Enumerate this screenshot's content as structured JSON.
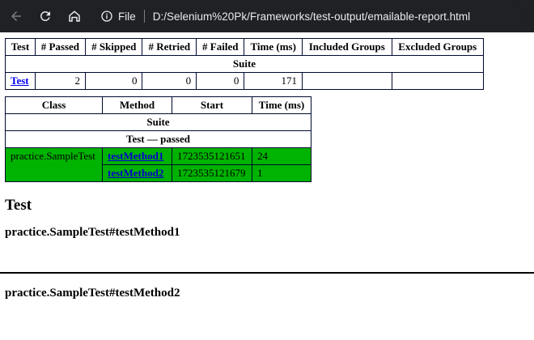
{
  "browser": {
    "file_label": "File",
    "url": "D:/Selenium%20Pk/Frameworks/test-output/emailable-report.html"
  },
  "summary": {
    "headers": [
      "Test",
      "# Passed",
      "# Skipped",
      "# Retried",
      "# Failed",
      "Time (ms)",
      "Included Groups",
      "Excluded Groups"
    ],
    "group_label": "Suite",
    "row": {
      "test": "Test",
      "passed": "2",
      "skipped": "0",
      "retried": "0",
      "failed": "0",
      "time": "171",
      "included": "",
      "excluded": ""
    }
  },
  "methods": {
    "headers": [
      "Class",
      "Method",
      "Start",
      "Time (ms)"
    ],
    "suite_label": "Suite",
    "test_label": "Test — passed",
    "rows": [
      {
        "class": "practice.SampleTest",
        "method": "testMethod1",
        "start": "1723535121651",
        "time": "24"
      },
      {
        "class": "",
        "method": "testMethod2",
        "start": "1723535121679",
        "time": "1"
      }
    ],
    "pass_color": "#00b300"
  },
  "details": {
    "section_title": "Test",
    "method1_title": "practice.SampleTest#testMethod1",
    "method2_title": "practice.SampleTest#testMethod2"
  }
}
